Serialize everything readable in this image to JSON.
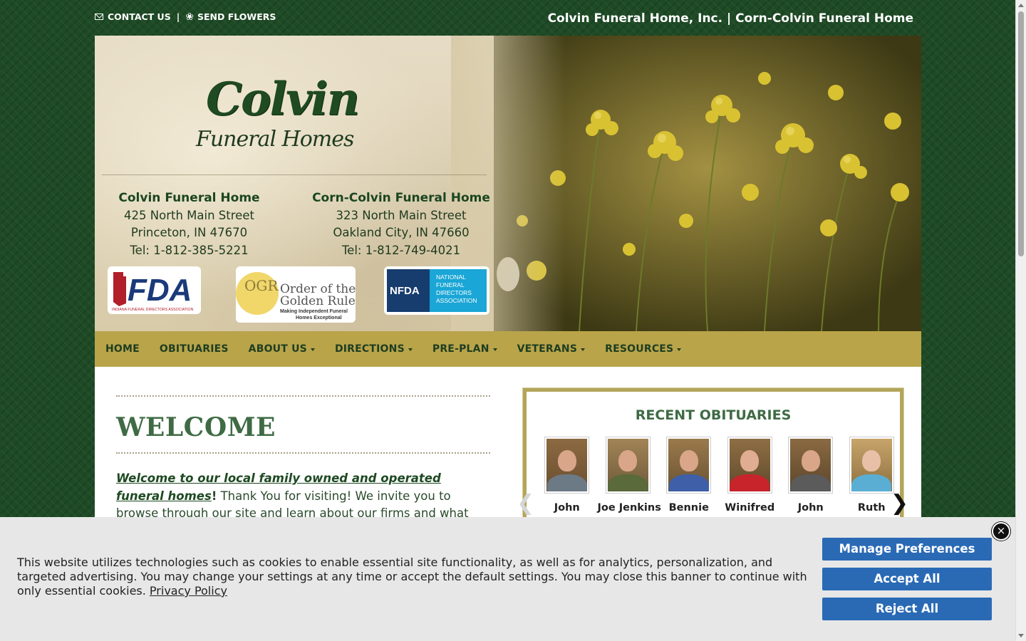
{
  "topbar": {
    "contact_label": "CONTACT US",
    "separator": "|",
    "flowers_label": "SEND FLOWERS",
    "site_title": "Colvin Funeral Home, Inc. | Corn-Colvin Funeral Home"
  },
  "logo": {
    "main": "Colvin",
    "sub": "Funeral Homes"
  },
  "locations": [
    {
      "name": "Colvin Funeral Home",
      "street": "425 North Main Street",
      "city": "Princeton, IN 47670",
      "tel_label": "Tel: ",
      "tel": "1-812-385-5221"
    },
    {
      "name": "Corn-Colvin Funeral Home",
      "street": "323 North Main Street",
      "city": "Oakland City, IN 47660",
      "tel_label": "Tel: ",
      "tel": "1-812-749-4021"
    }
  ],
  "badges": {
    "ifda_abbr": "FDA",
    "ifda_full": "INDIANA FUNERAL DIRECTORS ASSOCIATION",
    "ogr_letters": "OGR",
    "ogr_line1": "Order of the",
    "ogr_line2": "Golden Rule",
    "ogr_tagline1": "Making Independent Funeral",
    "ogr_tagline2": "Homes Exceptional",
    "nfda_abbr": "NFDA",
    "nfda_full1": "NATIONAL",
    "nfda_full2": "FUNERAL",
    "nfda_full3": "DIRECTORS",
    "nfda_full4": "ASSOCIATION"
  },
  "nav": {
    "items": [
      {
        "label": "HOME",
        "dropdown": false
      },
      {
        "label": "OBITUARIES",
        "dropdown": false
      },
      {
        "label": "ABOUT US",
        "dropdown": true
      },
      {
        "label": "DIRECTIONS",
        "dropdown": true
      },
      {
        "label": "PRE-PLAN",
        "dropdown": true
      },
      {
        "label": "VETERANS",
        "dropdown": true
      },
      {
        "label": "RESOURCES",
        "dropdown": true
      }
    ]
  },
  "welcome": {
    "heading": "WELCOME",
    "intro_link": "Welcome to our local family owned and operated funeral homes",
    "intro_bang": "!",
    "intro_rest": " Thank You for visiting! We invite you to browse through our site and learn about our firms and what services we can offer"
  },
  "obituaries": {
    "title": "RECENT OBITUARIES",
    "prev_icon": "chevron-left-icon",
    "next_icon": "chevron-right-icon",
    "items": [
      {
        "name": "John"
      },
      {
        "name": "Joe Jenkins"
      },
      {
        "name": "Bennie"
      },
      {
        "name": "Winifred"
      },
      {
        "name": "John"
      },
      {
        "name": "Ruth"
      }
    ]
  },
  "cookie": {
    "text": "This website utilizes technologies such as cookies to enable essential site functionality, as well as for analytics, personalization, and targeted advertising. You may change your settings at any time or accept the default settings. You may close this banner to continue with only essential cookies. ",
    "privacy_link": "Privacy Policy",
    "manage_label": "Manage Preferences",
    "accept_label": "Accept All",
    "reject_label": "Reject All",
    "close_symbol": "×"
  },
  "colors": {
    "background": "#1e4a25",
    "nav_bar": "#b9a44a",
    "heading_green": "#3f6b44",
    "button_blue": "#2a6ab5"
  }
}
